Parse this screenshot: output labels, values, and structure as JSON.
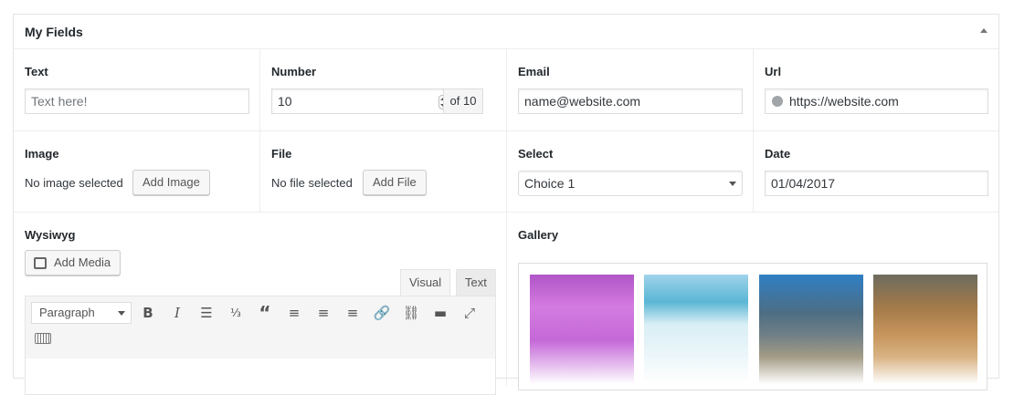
{
  "metabox": {
    "title": "My Fields"
  },
  "fields": {
    "text": {
      "label": "Text",
      "placeholder": "Text here!"
    },
    "number": {
      "label": "Number",
      "value": "10",
      "suffix": "of 10"
    },
    "email": {
      "label": "Email",
      "value": "name@website.com"
    },
    "url": {
      "label": "Url",
      "value": "https://website.com"
    },
    "image": {
      "label": "Image",
      "status": "No image selected",
      "button": "Add Image"
    },
    "file": {
      "label": "File",
      "status": "No file selected",
      "button": "Add File"
    },
    "select": {
      "label": "Select",
      "value": "Choice 1"
    },
    "date": {
      "label": "Date",
      "value": "01/04/2017"
    },
    "wysiwyg": {
      "label": "Wysiwyg",
      "add_media": "Add Media",
      "tab_visual": "Visual",
      "tab_text": "Text",
      "format": "Paragraph",
      "toolbar": [
        "bold-icon",
        "italic-icon",
        "bullet-list-icon",
        "numbered-list-icon",
        "blockquote-icon",
        "align-left-icon",
        "align-center-icon",
        "align-right-icon",
        "link-icon",
        "unlink-icon",
        "read-more-icon",
        "fullscreen-icon",
        "keyboard-icon"
      ]
    },
    "gallery": {
      "label": "Gallery"
    }
  }
}
